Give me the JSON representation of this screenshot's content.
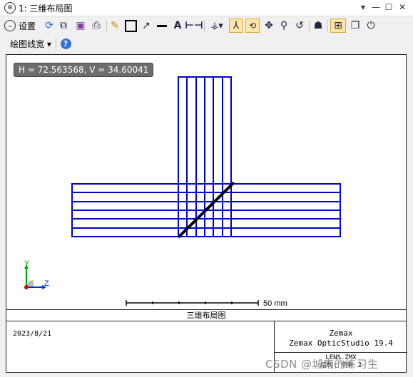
{
  "window": {
    "title": "1: 三维布局图",
    "controls": {
      "dropdown": "▾",
      "minimize": "—",
      "maximize": "☐",
      "close": "✕"
    }
  },
  "toolbar": {
    "settings_label": "设置",
    "plot_line_width_label": "绘图线宽 ▾",
    "icons": [
      "settings-chevron-icon",
      "refresh-icon",
      "copy-icon",
      "save-icon",
      "print-icon",
      "pencil-icon",
      "rectangle-icon",
      "arrow-icon",
      "line-icon",
      "text-icon",
      "dimension-icon",
      "rotate-icon",
      "axes-icon",
      "lock-icon",
      "pan-icon",
      "zoom-icon",
      "reset-icon",
      "user-icon",
      "layout-icon",
      "window-icon",
      "help-icon"
    ]
  },
  "plot": {
    "cursor_readout": "H = 72.563568, V = 34.60041",
    "scale_label": "50 mm",
    "axis_y": "Y",
    "axis_z": "Z",
    "ray_color": "#0000cc",
    "element_color": "#000000"
  },
  "footer": {
    "title": "三维布局图",
    "date": "2023/8/21",
    "brand_line1": "Zemax",
    "brand_line2": "Zemax OpticStudio 19.4",
    "file_line1": "LENS.ZMX",
    "file_line2": "结构: 所有 2"
  },
  "watermark": "CSDN @城南的练习生"
}
